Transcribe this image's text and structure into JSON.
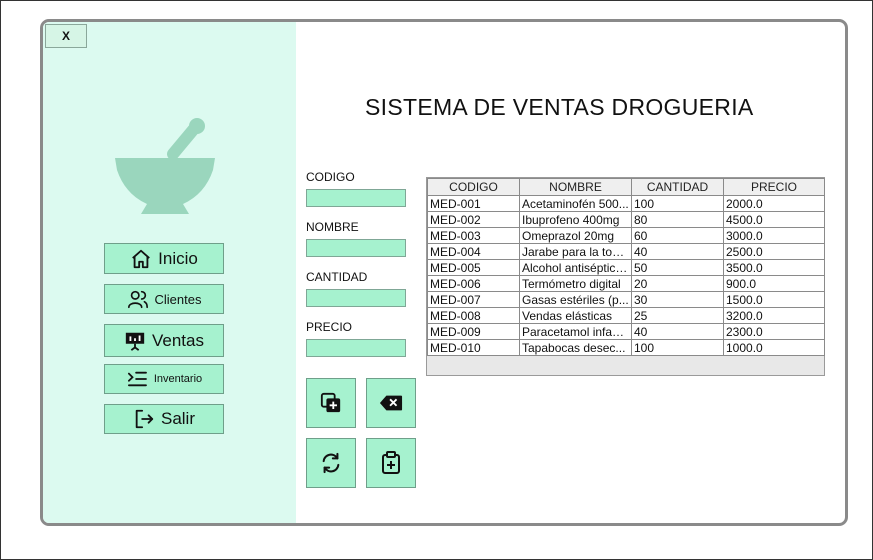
{
  "window": {
    "close_label": "X"
  },
  "title": "SISTEMA DE VENTAS DROGUERIA",
  "colors": {
    "sidebar_bg": "#dcfaf0",
    "accent": "#a6f2cf",
    "logo": "#9ad6bd"
  },
  "sidebar": {
    "logo_icon": "mortar-pestle-icon",
    "items": [
      {
        "label": "Inicio",
        "icon": "home-icon"
      },
      {
        "label": "Clientes",
        "icon": "users-icon"
      },
      {
        "label": "Ventas",
        "icon": "presentation-icon"
      },
      {
        "label": "Inventario",
        "icon": "list-indent-icon"
      },
      {
        "label": "Salir",
        "icon": "logout-icon"
      }
    ]
  },
  "form": {
    "codigo_label": "CODIGO",
    "nombre_label": "NOMBRE",
    "cantidad_label": "CANTIDAD",
    "precio_label": "PRECIO",
    "codigo_value": "",
    "nombre_value": "",
    "cantidad_value": "",
    "precio_value": ""
  },
  "actions": [
    {
      "icon": "add-copy-icon"
    },
    {
      "icon": "backspace-icon"
    },
    {
      "icon": "refresh-icon"
    },
    {
      "icon": "clipboard-plus-icon"
    }
  ],
  "table": {
    "columns": [
      "CODIGO",
      "NOMBRE",
      "CANTIDAD",
      "PRECIO"
    ],
    "rows": [
      [
        "MED-001",
        "Acetaminofén 500...",
        "100",
        "2000.0"
      ],
      [
        "MED-002",
        "Ibuprofeno 400mg",
        "80",
        "4500.0"
      ],
      [
        "MED-003",
        "Omeprazol 20mg",
        "60",
        "3000.0"
      ],
      [
        "MED-004",
        "Jarabe para la tos ...",
        "40",
        "2500.0"
      ],
      [
        "MED-005",
        "Alcohol antiséptico ...",
        "50",
        "3500.0"
      ],
      [
        "MED-006",
        "Termómetro digital",
        "20",
        "900.0"
      ],
      [
        "MED-007",
        "Gasas estériles (p...",
        "30",
        "1500.0"
      ],
      [
        "MED-008",
        "Vendas elásticas",
        "25",
        "3200.0"
      ],
      [
        "MED-009",
        "Paracetamol infant...",
        "40",
        "2300.0"
      ],
      [
        "MED-010",
        "Tapabocas desec...",
        "100",
        "1000.0"
      ]
    ]
  }
}
